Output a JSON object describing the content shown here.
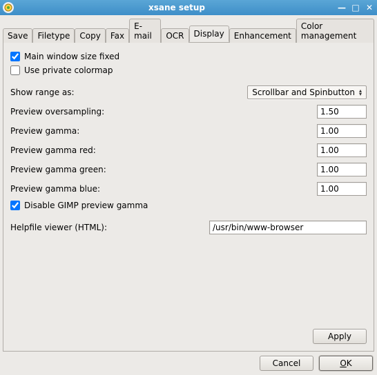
{
  "window": {
    "title": "xsane setup"
  },
  "tabs": {
    "items": [
      {
        "label": "Save"
      },
      {
        "label": "Filetype"
      },
      {
        "label": "Copy"
      },
      {
        "label": "Fax"
      },
      {
        "label": "E-mail"
      },
      {
        "label": "OCR"
      },
      {
        "label": "Display"
      },
      {
        "label": "Enhancement"
      },
      {
        "label": "Color management"
      }
    ],
    "active_index": 6
  },
  "display": {
    "main_window_fixed": {
      "label": "Main window size fixed",
      "checked": true
    },
    "use_private_colormap": {
      "label": "Use private colormap",
      "checked": false
    },
    "show_range_label": "Show range as:",
    "show_range_value": "Scrollbar and Spinbutton",
    "oversampling": {
      "label": "Preview oversampling:",
      "value": "1.50"
    },
    "gamma": {
      "label": "Preview gamma:",
      "value": "1.00"
    },
    "gamma_red": {
      "label": "Preview gamma red:",
      "value": "1.00"
    },
    "gamma_green": {
      "label": "Preview gamma green:",
      "value": "1.00"
    },
    "gamma_blue": {
      "label": "Preview gamma blue:",
      "value": "1.00"
    },
    "disable_gimp_gamma": {
      "label": "Disable GIMP preview gamma",
      "checked": true
    },
    "helpfile_viewer": {
      "label": "Helpfile viewer (HTML):",
      "value": "/usr/bin/www-browser"
    }
  },
  "buttons": {
    "apply": "Apply",
    "cancel": "Cancel",
    "ok_prefix": "O",
    "ok_suffix": "K"
  }
}
